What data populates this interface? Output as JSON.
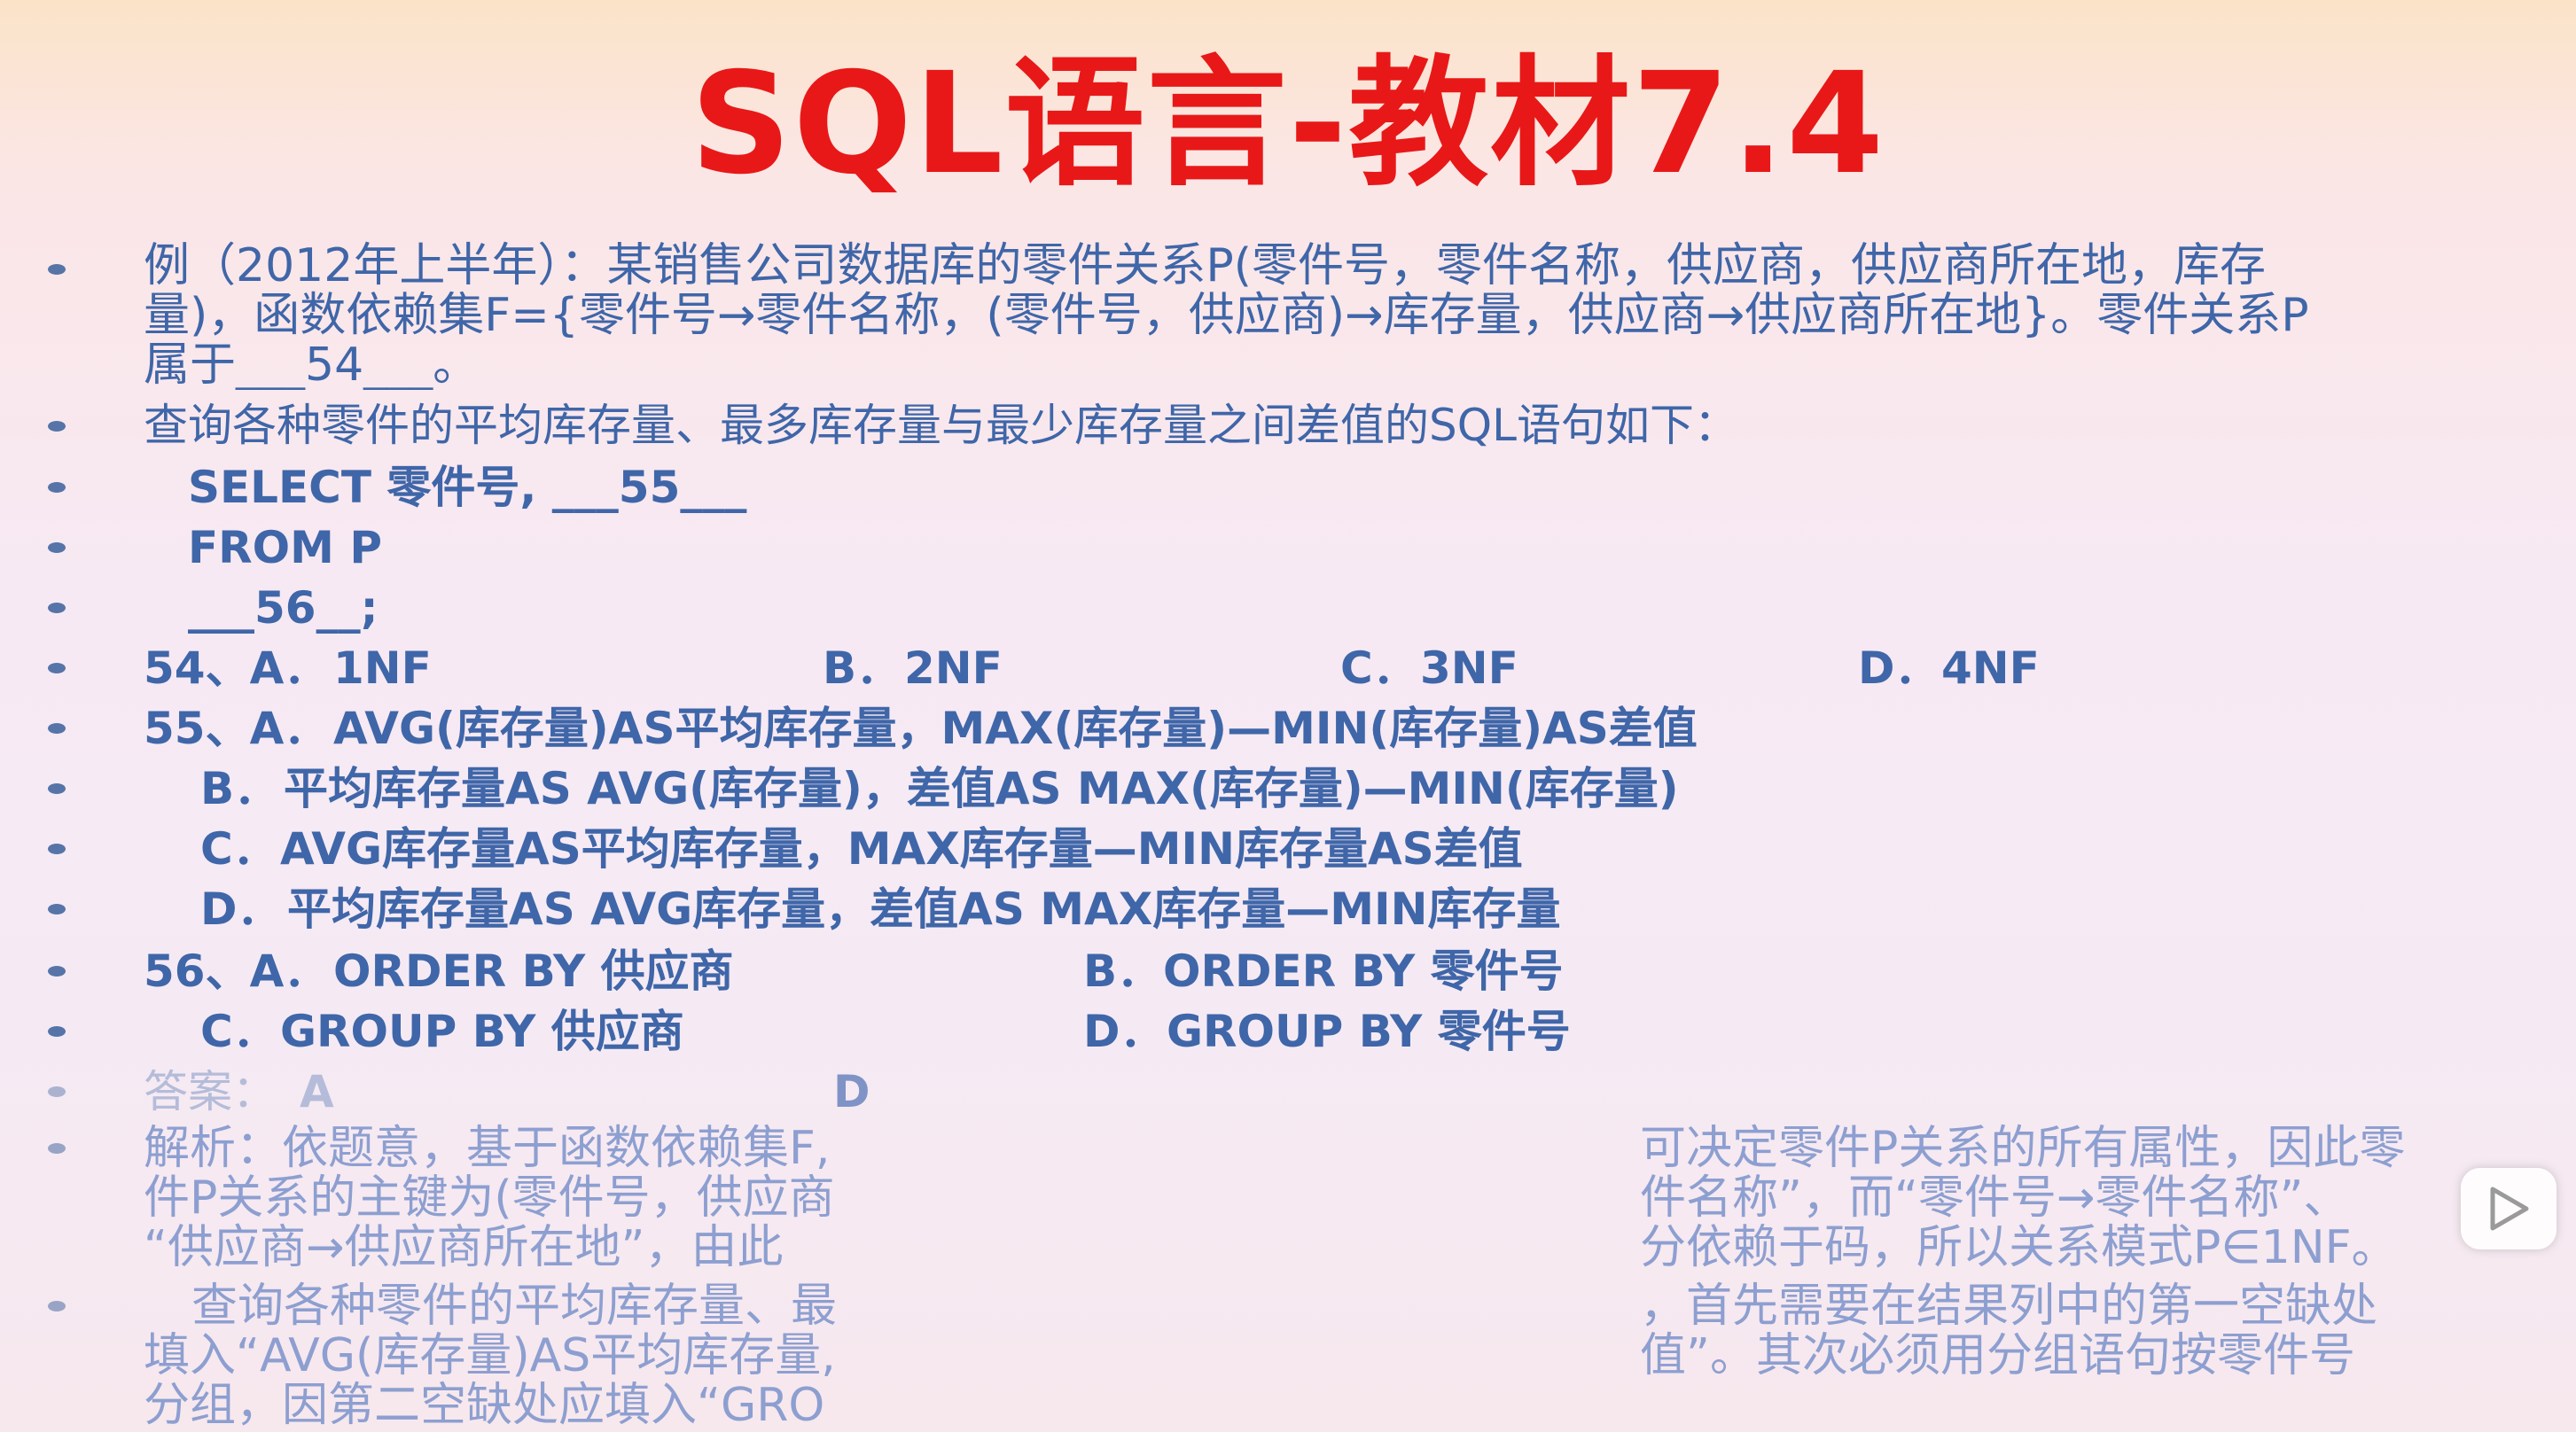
{
  "slide": {
    "title": "SQL语言-教材7.4",
    "example": {
      "lines": [
        "例（2012年上半年）：某销售公司数据库的零件关系P(零件号，零件名称，供应商，供应商所在地，库存",
        "量)，函数依赖集F={零件号→零件名称，(零件号，供应商)→库存量，供应商→供应商所在地}。零件关系P",
        "属于___54___。"
      ]
    },
    "query_intro": "查询各种零件的平均库存量、最多库存量与最少库存量之间差值的SQL语句如下：",
    "sql": {
      "select": "SELECT 零件号, ___55___",
      "from": "FROM P",
      "blank56": "___56__;"
    },
    "q54": {
      "label": "54、A．",
      "a": "1NF",
      "b_label": "B．",
      "b": "2NF",
      "c_label": "C．",
      "c": "3NF",
      "d_label": "D．",
      "d": "4NF"
    },
    "q55": {
      "label": "55、A．",
      "a": "AVG(库存量)AS平均库存量，MAX(库存量)—MIN(库存量)AS差值",
      "b_label": "B．",
      "b": "平均库存量AS AVG(库存量)，差值AS MAX(库存量)—MIN(库存量)",
      "c_label": "C．",
      "c": "AVG库存量AS平均库存量，MAX库存量—MIN库存量AS差值",
      "d_label": "D．",
      "d": "平均库存量AS AVG库存量，差值AS MAX库存量—MIN库存量"
    },
    "q56": {
      "label": "56、A．",
      "a": "ORDER BY 供应商",
      "b_label": "B．",
      "b": "ORDER BY 零件号",
      "c_label": "C．",
      "c": "GROUP BY 供应商",
      "d_label": "D．",
      "d": "GROUP BY 零件号"
    },
    "answer": {
      "label": "答案：",
      "a": "A",
      "d": "D"
    },
    "analysis": {
      "left_lines": [
        "解析：依题意，基于函数依赖集F,",
        "件P关系的主键为(零件号，供应商",
        "“供应商→供应商所在地”，由此"
      ],
      "right_lines": [
        "可决定零件P关系的所有属性，因此零",
        "件名称”，而“零件号→零件名称”、",
        "分依赖于码，所以关系模式P∈1NF。"
      ]
    },
    "analysis2": {
      "left_lines": [
        "查询各种零件的平均库存量、最",
        "填入“AVG(库存量)AS平均库存量,",
        "分组，因第二空缺处应填入“GRO"
      ],
      "right_lines": [
        "，首先需要在结果列中的第一空缺处",
        "值”。其次必须用分组语句按零件号"
      ]
    }
  },
  "player": {
    "play_icon": "play-icon"
  }
}
